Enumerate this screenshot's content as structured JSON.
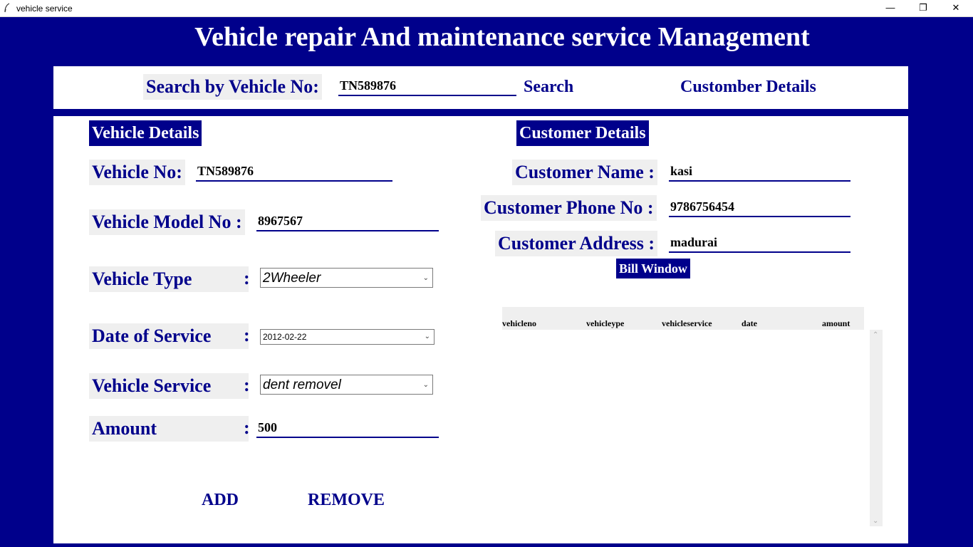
{
  "window": {
    "title": "vehicle service",
    "minimize": "—",
    "maximize": "❐",
    "close": "✕"
  },
  "app_title": "Vehicle repair And maintenance service Management",
  "search": {
    "label": "Search by Vehicle No:",
    "value": "TN589876",
    "button": "Search",
    "customer_button": "Customber Details"
  },
  "vehicle": {
    "header": "Vehicle Details",
    "no_label": "Vehicle No:",
    "no_value": "TN589876",
    "model_label": "Vehicle Model No :",
    "model_value": "8967567",
    "type_label": "Vehicle Type",
    "type_value": "2Wheeler",
    "date_label": "Date of Service",
    "date_value": "2012-02-22",
    "service_label": "Vehicle Service",
    "service_value": "dent removel",
    "amount_label": "Amount",
    "amount_value": "500",
    "colon": ":"
  },
  "customer": {
    "header": "Customer Details",
    "name_label": "Customer Name :",
    "name_value": "kasi",
    "phone_label": "Customer Phone No :",
    "phone_value": "9786756454",
    "address_label": "Customer Address :",
    "address_value": "madurai"
  },
  "buttons": {
    "bill_window": "Bill Window",
    "add": "ADD",
    "remove": "REMOVE"
  },
  "table": {
    "columns": [
      "vehicleno",
      "vehicleype",
      "vehicleservice",
      "date",
      "amount"
    ]
  },
  "icons": {
    "combo_arrow": "⌄",
    "scroll_up": "⌃",
    "scroll_down": "⌄"
  },
  "colors": {
    "primary": "#00008b",
    "label_bg": "#efefef"
  }
}
